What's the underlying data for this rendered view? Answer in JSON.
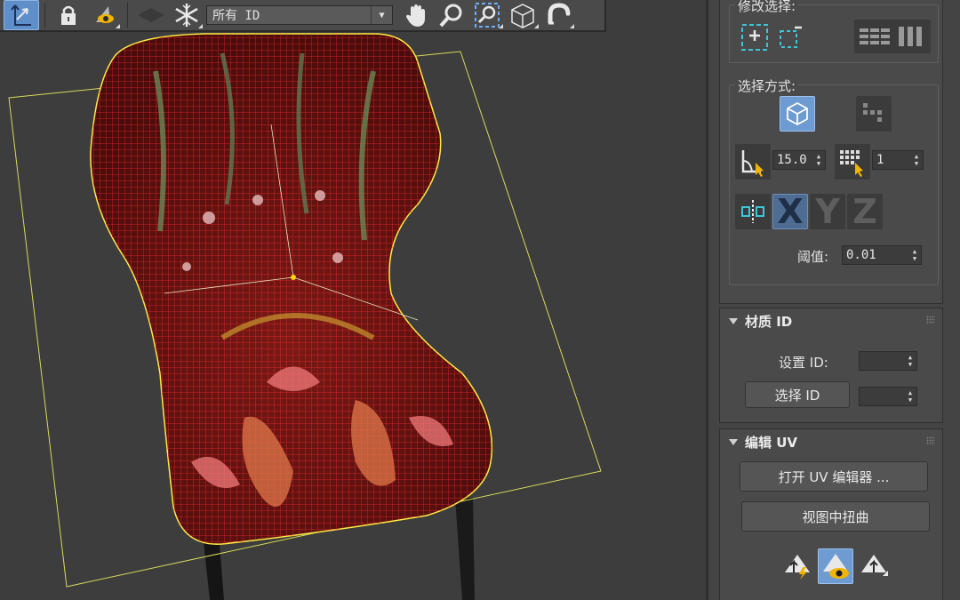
{
  "toolbar": {
    "selection_filter_value": "所有 ID",
    "tools": [
      "select-move-icon",
      "lock-icon",
      "show-end-result-icon",
      "shape-toggle-icon",
      "freeze-icon",
      "pan-icon",
      "zoom-icon",
      "zoom-region-icon",
      "cube-icon",
      "magnet-icon"
    ]
  },
  "panel": {
    "modify_selection": {
      "title": "修改选择:"
    },
    "selection_method": {
      "title": "选择方式:",
      "angle_value": "15.0",
      "ring_value": "1",
      "threshold_label": "阈值:",
      "threshold_value": "0.01",
      "axis_x": "X",
      "axis_y": "Y",
      "axis_z": "Z"
    },
    "material_id": {
      "title": "材质  ID",
      "set_id_label": "设置 ID:",
      "set_id_value": "",
      "select_id_button": "选择 ID",
      "select_id_value": ""
    },
    "edit_uv": {
      "title": "编辑  UV",
      "open_editor_button": "打开 UV 编辑器 ...",
      "tweak_in_view_button": "视图中扭曲"
    }
  },
  "colors": {
    "accent_active": "#6e9bd1",
    "wireframe": "#ff1e1e",
    "bounding_box": "#d9d95a",
    "viewport_bg": "#3d3d3d"
  }
}
